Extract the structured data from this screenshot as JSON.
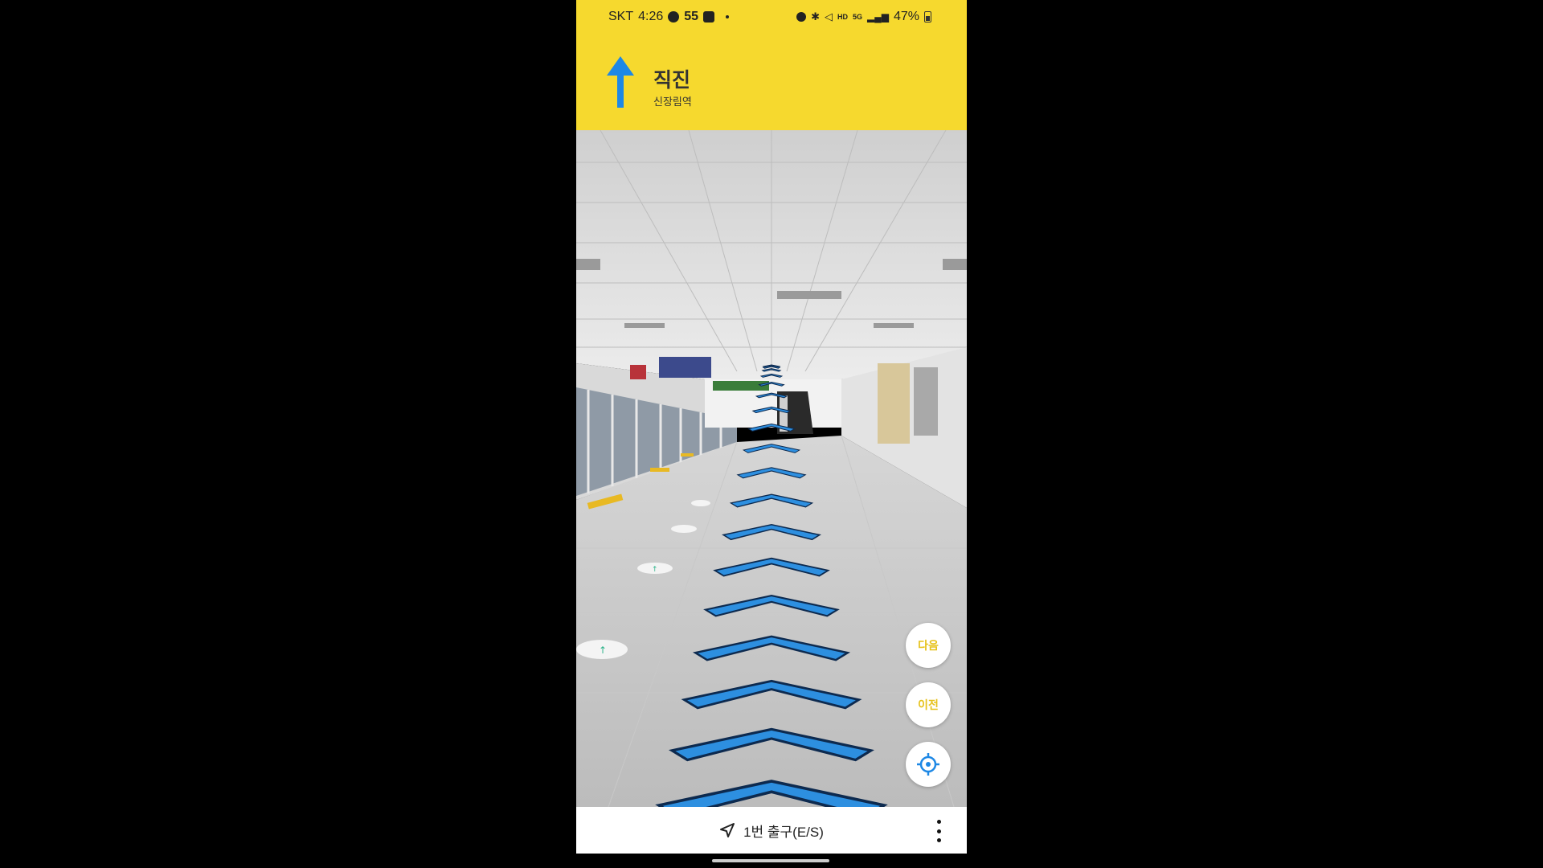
{
  "status_bar": {
    "carrier": "SKT",
    "time": "4:26",
    "notification_count": "55",
    "battery": "47%"
  },
  "direction": {
    "instruction": "직진",
    "station": "신장림역",
    "arrow_color": "#1e88e5"
  },
  "buttons": {
    "next_label": "다음",
    "prev_label": "이전",
    "locate_icon": "crosshair-icon"
  },
  "bottom_bar": {
    "destination": "1번 출구(E/S)"
  },
  "colors": {
    "header_bg": "#f6d92e",
    "button_text": "#e6c21b",
    "chevron": "#2d8fe0"
  }
}
